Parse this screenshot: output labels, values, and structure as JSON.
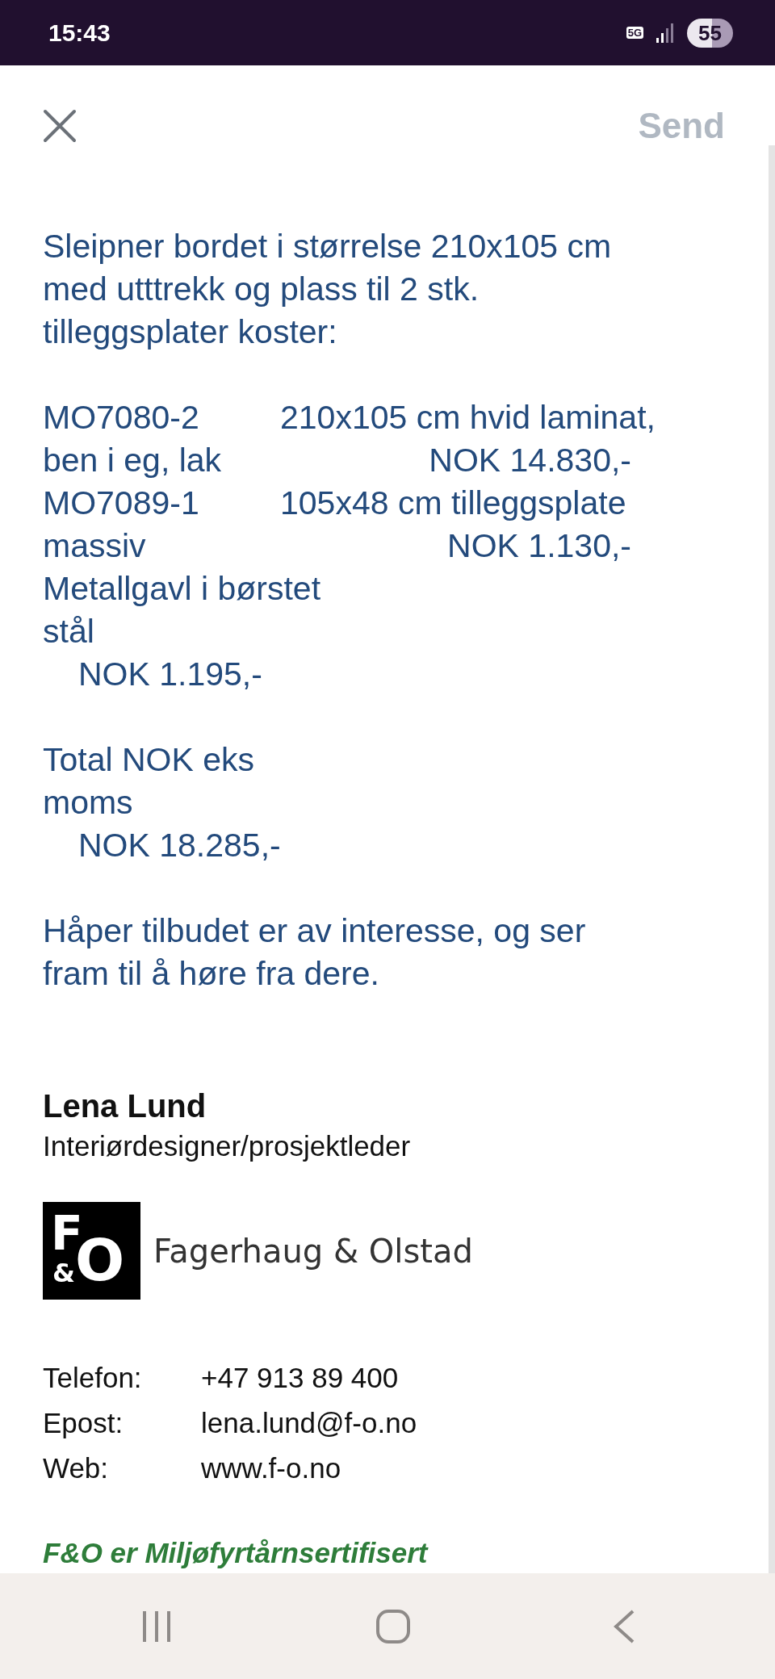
{
  "status_bar": {
    "time": "15:43",
    "network": "5G",
    "battery": "55"
  },
  "header": {
    "send": {
      "label": "Send",
      "disabled": true
    }
  },
  "message": {
    "intro_lines": [
      "Sleipner bordet i størrelse 210x105 cm",
      "med utttrekk og plass til 2 stk.",
      "tilleggsplater koster:"
    ],
    "price_lines": [
      {
        "kind": "item-head",
        "left": "MO7080-2",
        "right": "210x105 cm hvid laminat,"
      },
      {
        "kind": "item-price",
        "left": "ben i eg, lak",
        "right": "NOK 14.830,-"
      },
      {
        "kind": "item-head",
        "left": "MO7089-1",
        "right": "105x48 cm tilleggsplate"
      },
      {
        "kind": "item-price",
        "left": "massiv",
        "right": "NOK 1.130,-"
      },
      {
        "kind": "text",
        "left": "Metallgavl i børstet"
      },
      {
        "kind": "text",
        "left": "stål"
      },
      {
        "kind": "price",
        "left": "NOK 1.195,-"
      }
    ],
    "total_lines": [
      {
        "kind": "text",
        "left": "Total NOK eks"
      },
      {
        "kind": "text",
        "left": "moms"
      },
      {
        "kind": "price",
        "left": "NOK 18.285,-"
      }
    ],
    "closing_lines": [
      "Håper tilbudet er av interesse, og ser",
      "fram til å høre fra dere."
    ]
  },
  "signature": {
    "name": "Lena Lund",
    "title": "Interiørdesigner/prosjektleder",
    "logo": {
      "mark": [
        "F",
        "&",
        "O"
      ],
      "wordmark": "Fagerhaug & Olstad"
    },
    "contacts": [
      {
        "label": "Telefon:",
        "value": "+47 913 89 400"
      },
      {
        "label": "Epost:",
        "value": "lena.lund@f-o.no"
      },
      {
        "label": "Web:",
        "value": "www.f-o.no"
      }
    ],
    "certification": "F&O er Miljøfyrtårnsertifisert"
  }
}
